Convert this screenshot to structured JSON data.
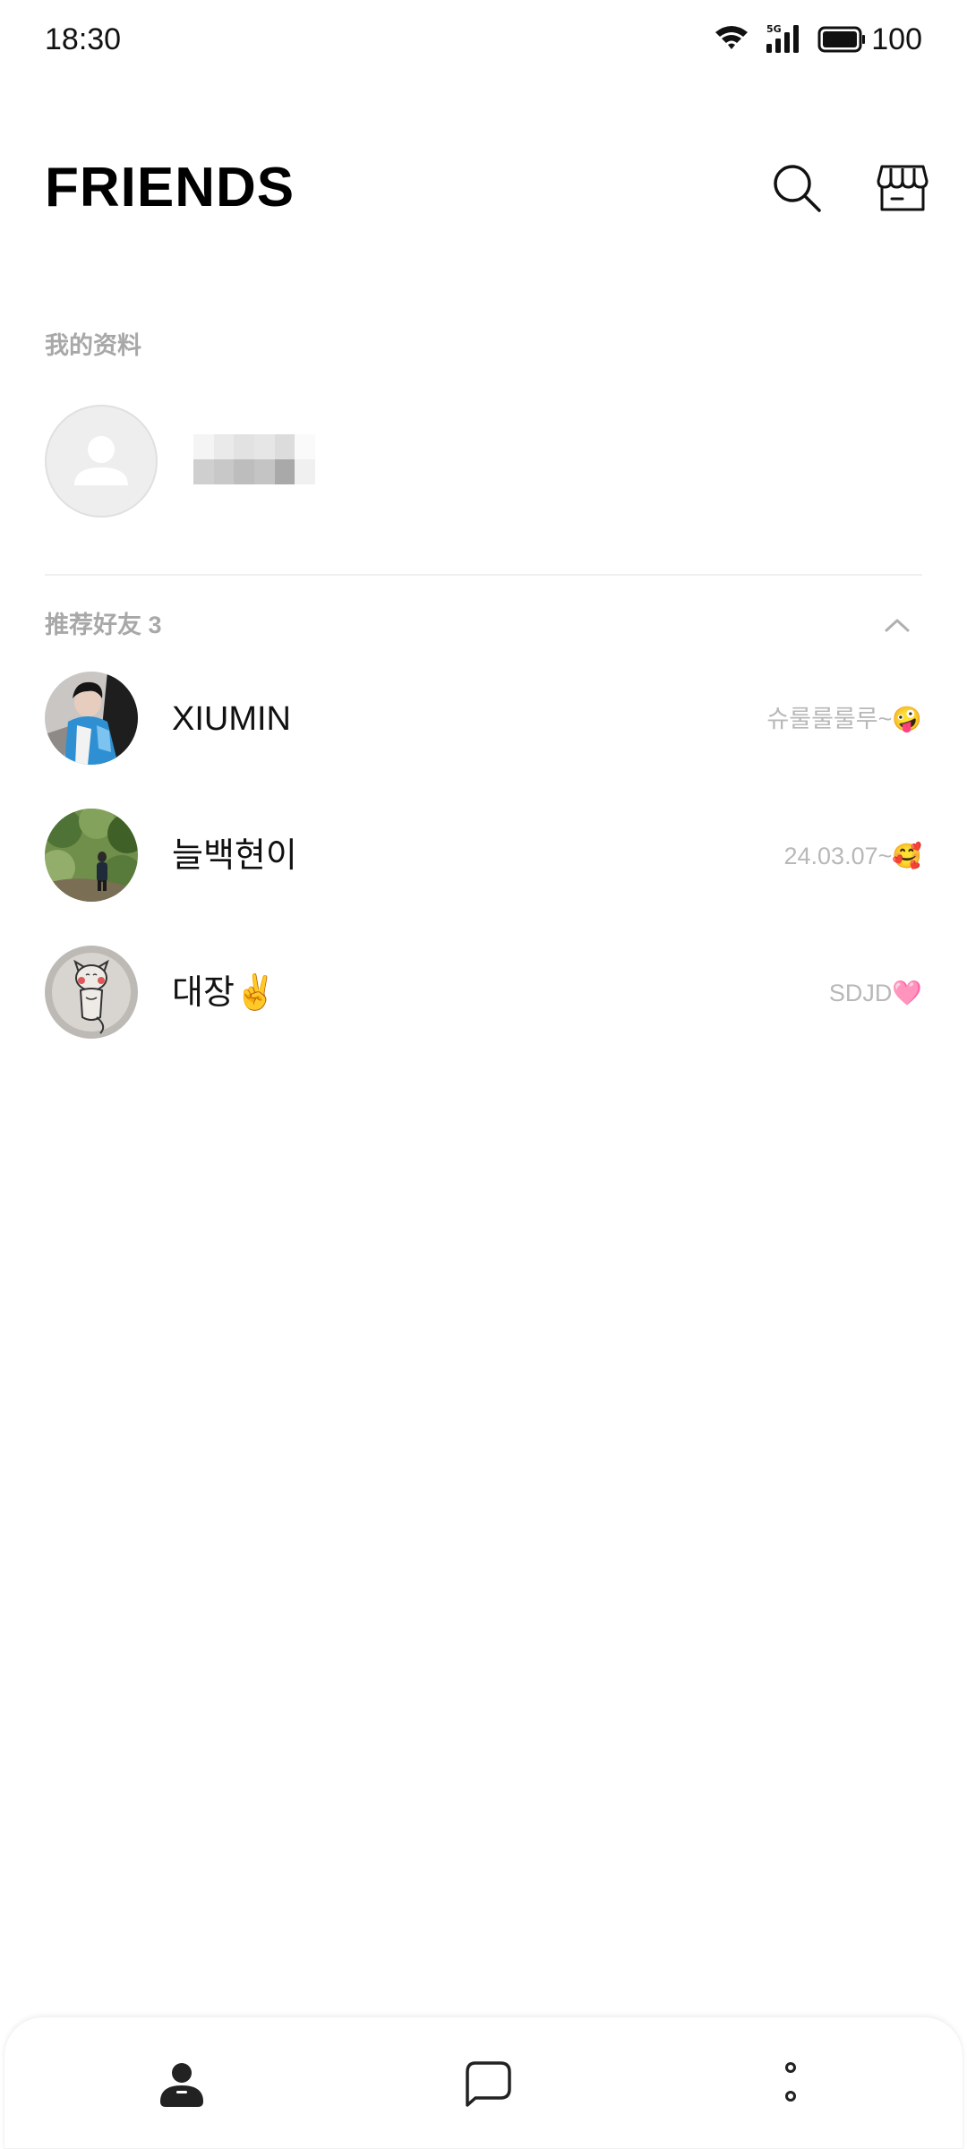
{
  "status_bar": {
    "time": "18:30",
    "network_label": "5G",
    "battery_level": "100",
    "icons": [
      "wifi-icon",
      "cellular-signal-icon",
      "battery-icon"
    ]
  },
  "header": {
    "title": "FRIENDS",
    "actions": [
      "search-icon",
      "shop-icon"
    ]
  },
  "my_profile": {
    "section_label": "我的资料",
    "avatar_icon": "default-person-icon",
    "name_redacted": true
  },
  "recommended": {
    "section_label": "推荐好友 3",
    "expanded": true,
    "friends": [
      {
        "name": "XIUMIN",
        "status": "슈룰룰룰루~🤪"
      },
      {
        "name": "늘백현이",
        "status": "24.03.07~🥰"
      },
      {
        "name": "대장✌️",
        "status": "SDJD🩷"
      }
    ]
  },
  "bottom_nav": {
    "items": [
      "friends-tab-icon",
      "chats-tab-icon",
      "more-tab-icon"
    ],
    "active": "friends-tab-icon"
  },
  "colors": {
    "section_label": "#a8a8a8",
    "status_text": "#b8b8b8",
    "divider": "#f0f0f0",
    "nav_active": "#222222"
  }
}
